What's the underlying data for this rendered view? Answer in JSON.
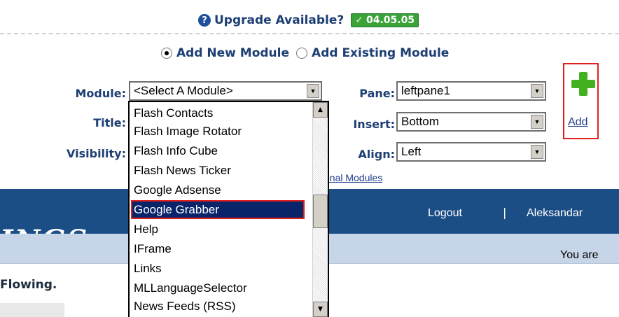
{
  "upgrade": {
    "text": "Upgrade Available?",
    "version": "04.05.05",
    "help_icon": "?"
  },
  "mode": {
    "add_new": "Add New Module",
    "add_existing": "Add Existing Module",
    "selected": "add_new"
  },
  "form": {
    "module_label": "Module:",
    "module_value": "<Select A Module>",
    "title_label": "Title:",
    "visibility_label": "Visibility:",
    "pane_label": "Pane:",
    "pane_value": "leftpane1",
    "insert_label": "Insert:",
    "insert_value": "Bottom",
    "align_label": "Align:",
    "align_value": "Left",
    "add_label": "Add",
    "add_icon": "plus-icon",
    "optional_link": "onal Modules"
  },
  "dropdown": {
    "options": [
      "Flash Contacts",
      "Flash Image Rotator",
      "Flash Info Cube",
      "Flash News Ticker",
      "Google Adsense",
      "Google Grabber",
      "Help",
      "IFrame",
      "Links",
      "MLLanguageSelector",
      "News Feeds (RSS)"
    ],
    "selected_index": 5
  },
  "page": {
    "logo_text": "INGS",
    "logout": "Logout",
    "separator": "|",
    "user": "Aleksandar",
    "breadcrumb_partial": "You are",
    "tagline_partial": "Flowing."
  },
  "colors": {
    "accent_blue": "#1c4e86",
    "label_blue": "#1d3f74",
    "highlight_red": "#e0201c",
    "selection": "#0a246a",
    "version_green": "#39a33a"
  }
}
